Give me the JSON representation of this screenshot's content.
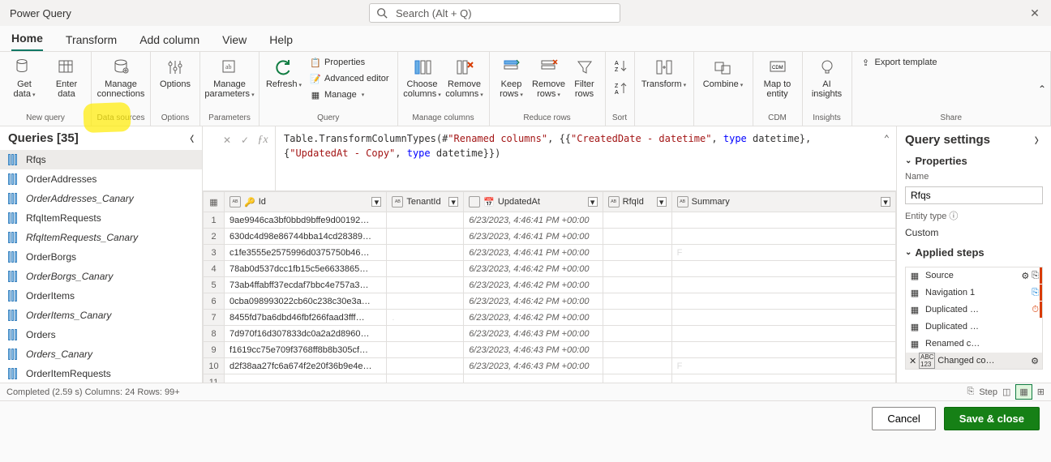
{
  "app": {
    "title": "Power Query",
    "search_placeholder": "Search (Alt + Q)"
  },
  "tabs": [
    "Home",
    "Transform",
    "Add column",
    "View",
    "Help"
  ],
  "ribbon": {
    "groups": [
      {
        "name": "New query",
        "buttons": [
          {
            "label": "Get\ndata",
            "caret": true
          },
          {
            "label": "Enter\ndata"
          }
        ]
      },
      {
        "name": "Data sources",
        "buttons": [
          {
            "label": "Manage\nconnections"
          }
        ]
      },
      {
        "name": "Options",
        "buttons": [
          {
            "label": "Options"
          }
        ]
      },
      {
        "name": "Parameters",
        "buttons": [
          {
            "label": "Manage\nparameters",
            "caret": true
          }
        ]
      },
      {
        "name": "Query",
        "big": {
          "label": "Refresh",
          "caret": true
        },
        "rows": [
          "Properties",
          "Advanced editor",
          "Manage"
        ]
      },
      {
        "name": "Manage columns",
        "buttons": [
          {
            "label": "Choose\ncolumns",
            "caret": true
          },
          {
            "label": "Remove\ncolumns",
            "caret": true
          }
        ]
      },
      {
        "name": "Reduce rows",
        "buttons": [
          {
            "label": "Keep\nrows",
            "caret": true
          },
          {
            "label": "Remove\nrows",
            "caret": true
          },
          {
            "label": "Filter\nrows"
          }
        ]
      },
      {
        "name": "Sort",
        "buttons": []
      },
      {
        "name": "",
        "buttons": [
          {
            "label": "Transform",
            "caret": true
          }
        ]
      },
      {
        "name": "",
        "buttons": [
          {
            "label": "Combine",
            "caret": true
          }
        ]
      },
      {
        "name": "CDM",
        "buttons": [
          {
            "label": "Map to\nentity"
          }
        ]
      },
      {
        "name": "Insights",
        "buttons": [
          {
            "label": "AI\ninsights"
          }
        ]
      },
      {
        "name": "Share",
        "rows": [
          "Export template"
        ]
      }
    ]
  },
  "queries": {
    "title": "Queries [35]",
    "items": [
      {
        "name": "Rfqs",
        "sel": true
      },
      {
        "name": "OrderAddresses"
      },
      {
        "name": "OrderAddresses_Canary",
        "italic": true
      },
      {
        "name": "RfqItemRequests"
      },
      {
        "name": "RfqItemRequests_Canary",
        "italic": true
      },
      {
        "name": "OrderBorgs"
      },
      {
        "name": "OrderBorgs_Canary",
        "italic": true
      },
      {
        "name": "OrderItems"
      },
      {
        "name": "OrderItems_Canary",
        "italic": true
      },
      {
        "name": "Orders"
      },
      {
        "name": "Orders_Canary",
        "italic": true
      },
      {
        "name": "OrderItemRequests"
      }
    ]
  },
  "formula": {
    "l1a": "Table.TransformColumnTypes(#",
    "l1b": "\"Renamed columns\"",
    "l1c": ", {{",
    "l1d": "\"CreatedDate - datetime\"",
    "l1e": ", ",
    "l1f": "type",
    "l1g": " datetime},",
    "l2a": "{",
    "l2b": "\"UpdatedAt - Copy\"",
    "l2c": ", ",
    "l2d": "type",
    "l2e": " datetime}})"
  },
  "grid": {
    "columns": [
      {
        "label": "Id",
        "type": "ABC",
        "key": true
      },
      {
        "label": "TenantId",
        "type": "ABC"
      },
      {
        "label": "UpdatedAt",
        "type": "date"
      },
      {
        "label": "RfqId",
        "type": "ABC"
      },
      {
        "label": "Summary",
        "type": "ABC"
      }
    ],
    "rows": [
      {
        "n": 1,
        "id": "9ae9946ca3bf0bbd9bffe9d00192…",
        "t": "",
        "u": "6/23/2023, 4:46:41 PM +00:00",
        "r": "",
        "s": ""
      },
      {
        "n": 2,
        "id": "630dc4d98e86744bba14cd28389…",
        "t": "",
        "u": "6/23/2023, 4:46:41 PM +00:00",
        "r": "",
        "s": ""
      },
      {
        "n": 3,
        "id": "c1fe3555e2575996d0375750b46…",
        "t": "",
        "u": "6/23/2023, 4:46:41 PM +00:00",
        "r": "",
        "s": "F"
      },
      {
        "n": 4,
        "id": "78ab0d537dcc1fb15c5e6633865…",
        "t": "",
        "u": "6/23/2023, 4:46:42 PM +00:00",
        "r": "",
        "s": ""
      },
      {
        "n": 5,
        "id": "73ab4ffabff37ecdaf7bbc4e757a3…",
        "t": "",
        "u": "6/23/2023, 4:46:42 PM +00:00",
        "r": "",
        "s": ""
      },
      {
        "n": 6,
        "id": "0cba098993022cb60c238c30e3a…",
        "t": "",
        "u": "6/23/2023, 4:46:42 PM +00:00",
        "r": "",
        "s": ""
      },
      {
        "n": 7,
        "id": "8455fd7ba6dbd46fbf266faad3fff…",
        "t": ".",
        "u": "6/23/2023, 4:46:42 PM +00:00",
        "r": "",
        "s": ""
      },
      {
        "n": 8,
        "id": "7d970f16d307833dc0a2a2d8960…",
        "t": "",
        "u": "6/23/2023, 4:46:43 PM +00:00",
        "r": "",
        "s": ""
      },
      {
        "n": 9,
        "id": "f1619cc75e709f3768ff8b8b305cf…",
        "t": "",
        "u": "6/23/2023, 4:46:43 PM +00:00",
        "r": "",
        "s": ""
      },
      {
        "n": 10,
        "id": "d2f38aa27fc6a674f2e20f36b9e4e…",
        "t": "",
        "u": "6/23/2023, 4:46:43 PM +00:00",
        "r": "",
        "s": "F"
      },
      {
        "n": 11,
        "id": "",
        "t": "",
        "u": "",
        "r": "",
        "s": ""
      }
    ]
  },
  "settings": {
    "title": "Query settings",
    "props": "Properties",
    "name_label": "Name",
    "name_value": "Rfqs",
    "entity_label": "Entity type",
    "entity_value": "Custom",
    "applied": "Applied steps",
    "steps": [
      {
        "label": "Source",
        "gear": true,
        "pop": true
      },
      {
        "label": "Navigation 1",
        "pop2": true
      },
      {
        "label": "Duplicated …",
        "warn": true
      },
      {
        "label": "Duplicated …"
      },
      {
        "label": "Renamed c…"
      },
      {
        "label": "Changed co…",
        "gear": true,
        "sel": true,
        "del": true,
        "abc": true
      }
    ]
  },
  "status": {
    "main": "Completed (2.59 s)   Columns: 24   Rows: 99+",
    "step": "Step"
  },
  "footer": {
    "cancel": "Cancel",
    "save": "Save & close"
  }
}
